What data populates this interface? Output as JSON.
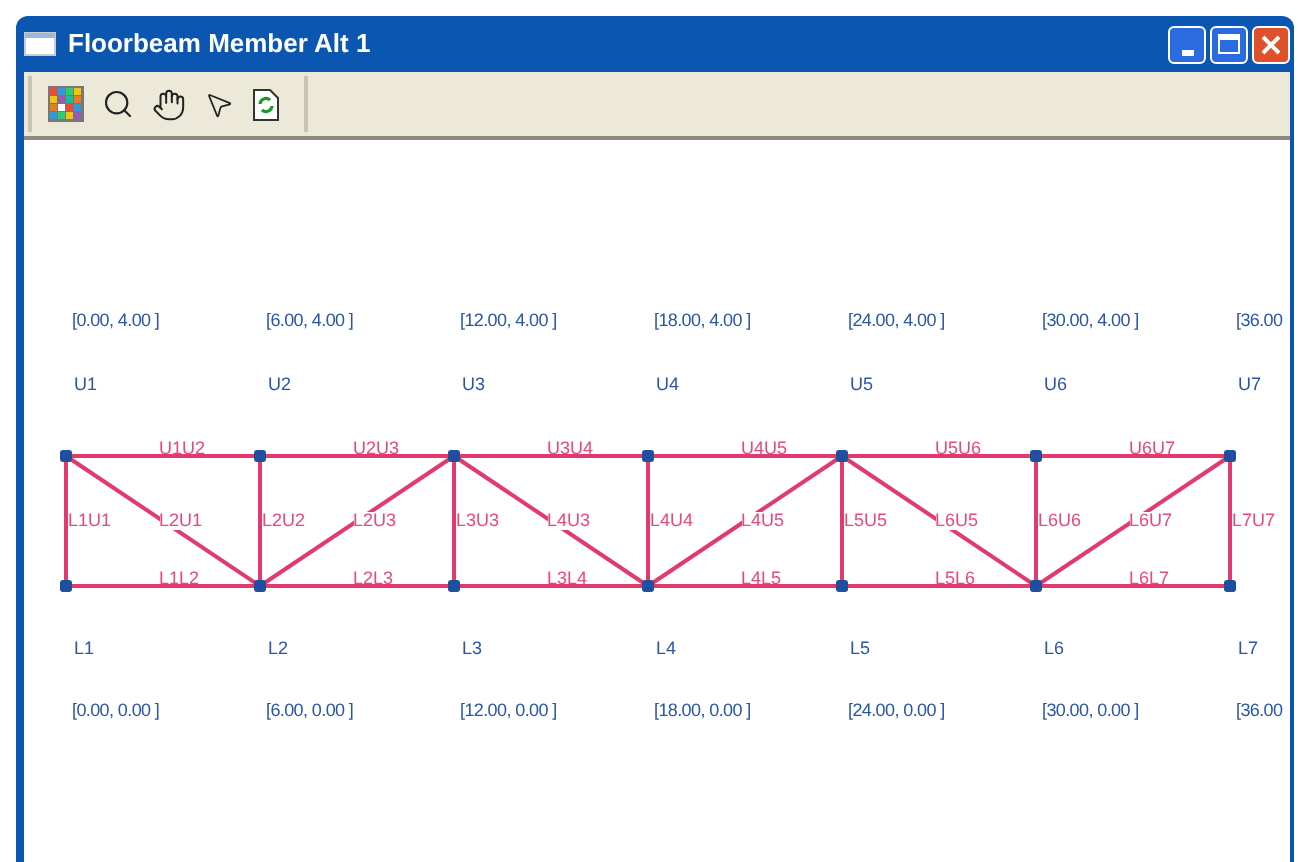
{
  "window": {
    "title": "Floorbeam Member Alt 1"
  },
  "upper_nodes": [
    {
      "name": "U1",
      "coord": "[0.00, 4.00 ]"
    },
    {
      "name": "U2",
      "coord": "[6.00, 4.00 ]"
    },
    {
      "name": "U3",
      "coord": "[12.00, 4.00 ]"
    },
    {
      "name": "U4",
      "coord": "[18.00, 4.00 ]"
    },
    {
      "name": "U5",
      "coord": "[24.00, 4.00 ]"
    },
    {
      "name": "U6",
      "coord": "[30.00, 4.00 ]"
    },
    {
      "name": "U7",
      "coord": "[36.00"
    }
  ],
  "lower_nodes": [
    {
      "name": "L1",
      "coord": "[0.00, 0.00 ]"
    },
    {
      "name": "L2",
      "coord": "[6.00, 0.00 ]"
    },
    {
      "name": "L3",
      "coord": "[12.00, 0.00 ]"
    },
    {
      "name": "L4",
      "coord": "[18.00, 0.00 ]"
    },
    {
      "name": "L5",
      "coord": "[24.00, 0.00 ]"
    },
    {
      "name": "L6",
      "coord": "[30.00, 0.00 ]"
    },
    {
      "name": "L7",
      "coord": "[36.00"
    }
  ],
  "top_chords": [
    "U1U2",
    "U2U3",
    "U3U4",
    "U4U5",
    "U5U6",
    "U6U7"
  ],
  "bottom_chords": [
    "L1L2",
    "L2L3",
    "L3L4",
    "L4L5",
    "L5L6",
    "L6L7"
  ],
  "verticals": [
    "L1U1",
    "L2U2",
    "L3U3",
    "L4U4",
    "L5U5",
    "L6U6",
    "L7U7"
  ],
  "diagonals": [
    {
      "label": "L2U1",
      "kind": "falling"
    },
    {
      "label": "L2U3",
      "kind": "rising"
    },
    {
      "label": "L4U3",
      "kind": "falling"
    },
    {
      "label": "L4U5",
      "kind": "rising"
    },
    {
      "label": "L6U5",
      "kind": "falling"
    },
    {
      "label": "L6U7",
      "kind": "rising"
    }
  ]
}
